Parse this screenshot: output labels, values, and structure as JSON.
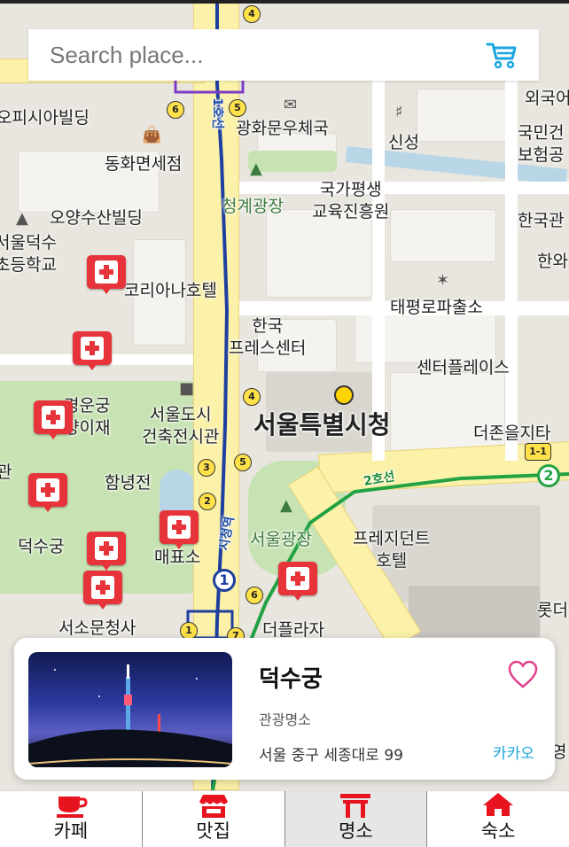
{
  "search": {
    "placeholder": "Search place..."
  },
  "map": {
    "labels": {
      "officia": "오피시아빌딩",
      "dutyfree": "동화면세점",
      "gwanghwamun_post": "광화문우체국",
      "shinsung": "신성",
      "cheonggye": "청계광장",
      "promo": "국가평생\n교육진흥원",
      "oyang": "오양수산빌딩",
      "koreana": "코리아나호텔",
      "press": "한국\n프레스센터",
      "taepyeong": "태평로파출소",
      "centerplace": "센터플레이스",
      "seoul_arch": "서울도시\n건축전시관",
      "cityhall": "서울특별시청",
      "gyeongun": "경운궁\n양이재",
      "hamnyeong": "함녕전",
      "deoksugung": "덕수궁",
      "maepyoso": "매표소",
      "seoulplaza": "서울광장",
      "president": "프레지던트\n호텔",
      "plaza_hotel": "더플라자",
      "seoso": "서소문청사",
      "thejoins": "더존을지타",
      "line1": "1호선",
      "line2": "2호선",
      "cityhall_stn": "시청역",
      "oeguk": "외국어",
      "gukmin": "국민건\n보험공",
      "hanguk": "한국관",
      "hanwha": "한와",
      "deoksu_school": "서울덕수\n초등학교",
      "lotte": "롯더",
      "young": "영",
      "gwan": "관"
    },
    "station_numbers": [
      "4",
      "6",
      "5",
      "4",
      "3",
      "5",
      "2",
      "6",
      "1",
      "7",
      "1-1"
    ],
    "colors": {
      "line1": "#1e3fa0",
      "line2": "#23a243",
      "hospital": "#e7343b",
      "road_major": "#fbf1a8"
    }
  },
  "card": {
    "name": "덕수궁",
    "category": "관광명소",
    "address": "서울 중구 세종대로 99",
    "link_label": "카카오",
    "heart_color": "#e0408a"
  },
  "tabs": [
    {
      "label": "카페",
      "icon": "cafe-icon",
      "active": false
    },
    {
      "label": "맛집",
      "icon": "store-icon",
      "active": false
    },
    {
      "label": "명소",
      "icon": "gate-icon",
      "active": true
    },
    {
      "label": "숙소",
      "icon": "home-icon",
      "active": false
    }
  ]
}
